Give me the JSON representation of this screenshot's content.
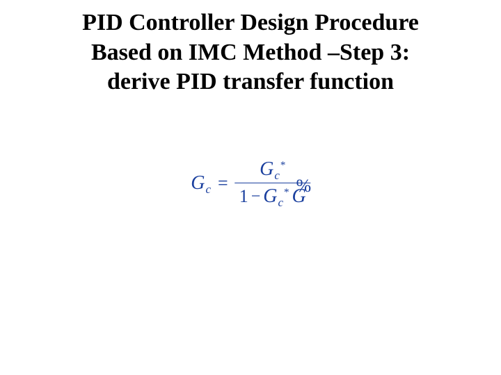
{
  "title": {
    "line1": "PID Controller Design Procedure",
    "line2": "Based on IMC Method –Step 3:",
    "line3": "derive PID transfer function"
  },
  "equation": {
    "lhs_G": "G",
    "lhs_sub": "c",
    "equals": "=",
    "num_G": "G",
    "num_sub": "c",
    "num_star": "*",
    "den_one": "1",
    "den_minus": "−",
    "den_G1": "G",
    "den_sub1": "c",
    "den_star1": "*",
    "den_tilde": "%",
    "den_G2": "G"
  }
}
